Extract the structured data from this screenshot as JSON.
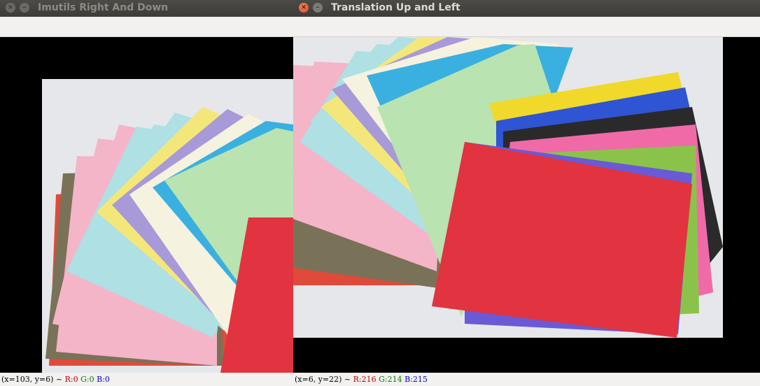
{
  "windows": [
    {
      "title": "Imutils Right And Down",
      "status": {
        "coords": "(x=103, y=6) ~ ",
        "r": "R:0",
        "g": "G:0",
        "b": "B:0"
      }
    },
    {
      "title": "Translation Up and Left",
      "status": {
        "coords": "(x=6, y=22) ~ ",
        "r": "R:216",
        "g": "G:214",
        "b": "B:215"
      }
    }
  ],
  "buttons": {
    "close": "×",
    "minimize": "–"
  },
  "colors": {
    "red": "#e23340",
    "green": "#8bc34a",
    "pink_bright": "#f06aa8",
    "black": "#2a2a2a",
    "blue": "#2f55d4",
    "yellow": "#f0d92a",
    "light_green": "#b9e3b0",
    "sky": "#3ab0e0",
    "cream": "#f5f2e0",
    "lavender": "#a89ad8",
    "pale_yellow": "#f4e77a",
    "cyan": "#aee0e4",
    "pale_pink": "#f4b5c8",
    "khaki": "#7a7258",
    "orange_red": "#e04a3a",
    "background": "#e6e7ea"
  }
}
